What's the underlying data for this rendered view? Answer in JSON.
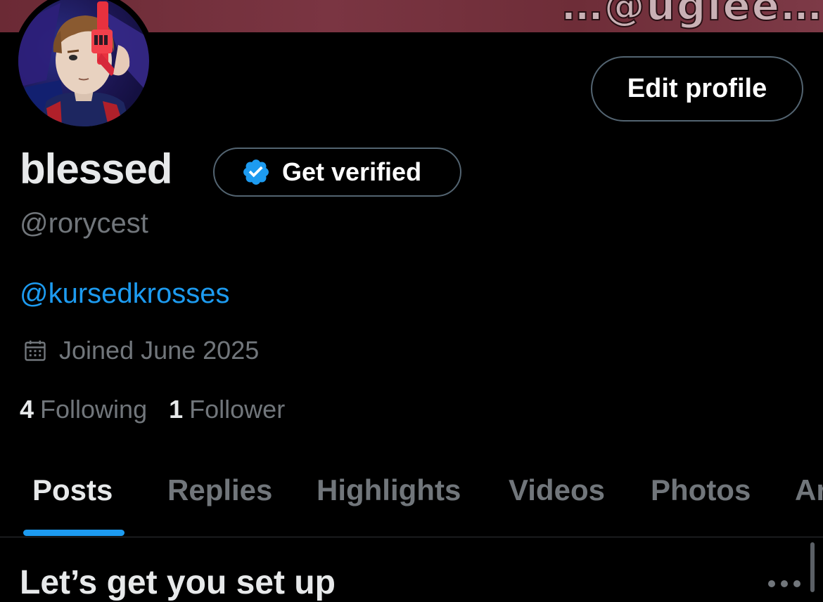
{
  "banner": {
    "text": "…@uglee…",
    "color": "#6b2a35"
  },
  "avatar": {
    "alt": "profile avatar"
  },
  "profile": {
    "edit_button_label": "Edit profile",
    "name": "blessed",
    "verify_button_label": "Get verified",
    "handle": "@rorycest",
    "bio_link": "@kursedkrosses",
    "joined_icon": "calendar-icon",
    "joined_text": "Joined June 2025",
    "following_count": "4",
    "following_label": "Following",
    "followers_count": "1",
    "followers_label": "Follower"
  },
  "tabs": [
    {
      "label": "Posts",
      "active": true
    },
    {
      "label": "Replies",
      "active": false
    },
    {
      "label": "Highlights",
      "active": false
    },
    {
      "label": "Videos",
      "active": false
    },
    {
      "label": "Photos",
      "active": false
    },
    {
      "label": "Ar",
      "active": false
    }
  ],
  "setup": {
    "title": "Let’s get you set up",
    "more_icon": "more-horizontal-icon"
  },
  "colors": {
    "background": "#000000",
    "accent": "#1d9bf0",
    "primary_text": "#e7e9ea",
    "secondary_text": "#71767b",
    "border": "#536471"
  }
}
